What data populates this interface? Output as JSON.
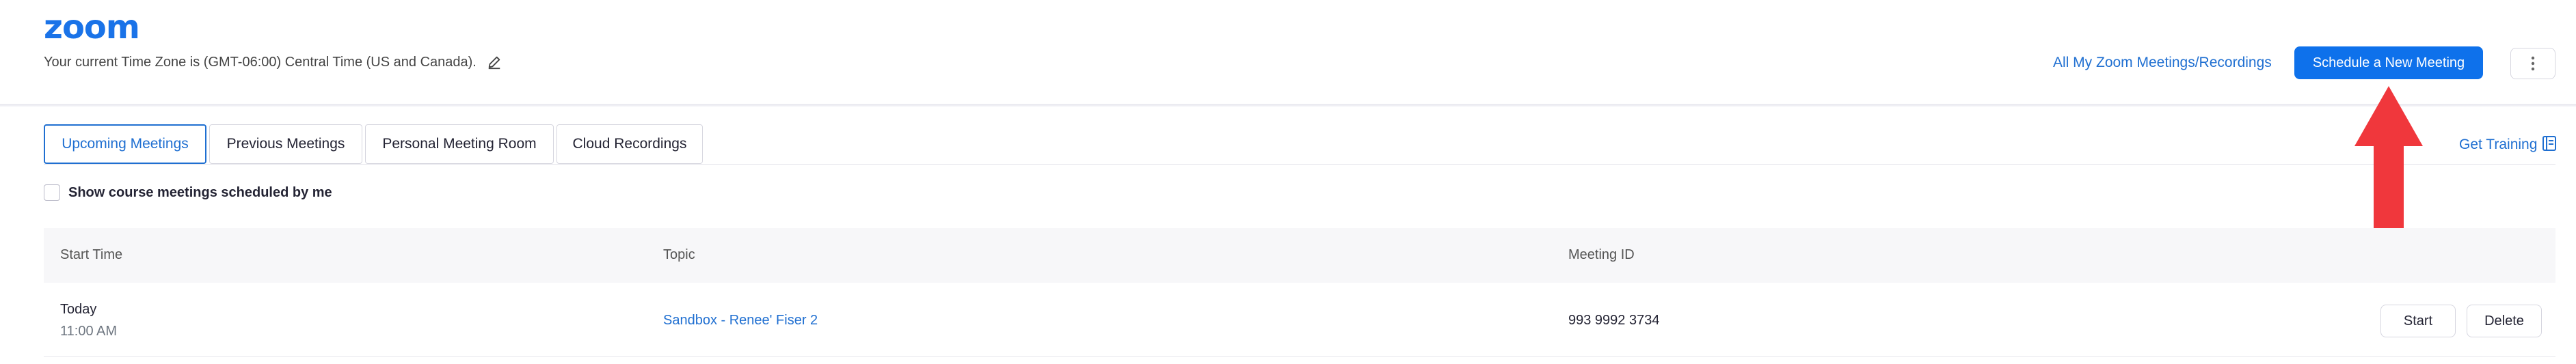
{
  "header": {
    "logo": "zoom",
    "timezone_text": "Your current Time Zone is (GMT-06:00) Central Time (US and Canada).",
    "all_meetings_link": "All My Zoom Meetings/Recordings",
    "schedule_button": "Schedule a New Meeting",
    "more_icon": "vertical-dots-icon"
  },
  "tabs": [
    {
      "label": "Upcoming Meetings",
      "active": true
    },
    {
      "label": "Previous Meetings",
      "active": false
    },
    {
      "label": "Personal Meeting Room",
      "active": false
    },
    {
      "label": "Cloud Recordings",
      "active": false
    }
  ],
  "get_training": "Get Training",
  "filter": {
    "show_course_label": "Show course meetings scheduled by me",
    "checked": false
  },
  "table": {
    "columns": [
      "Start Time",
      "Topic",
      "Meeting ID"
    ],
    "rows": [
      {
        "day": "Today",
        "time": "11:00 AM",
        "topic": "Sandbox - Renee' Fiser 2",
        "meeting_id": "993 9992 3734",
        "actions": [
          "Start",
          "Delete"
        ]
      }
    ]
  },
  "colors": {
    "brand": "#1a73e8",
    "primary_button": "#0e71eb",
    "link": "#1f6fd1",
    "annotation_arrow": "#f0373c"
  },
  "icons": [
    "pencil-icon",
    "vertical-dots-icon",
    "book-icon"
  ]
}
